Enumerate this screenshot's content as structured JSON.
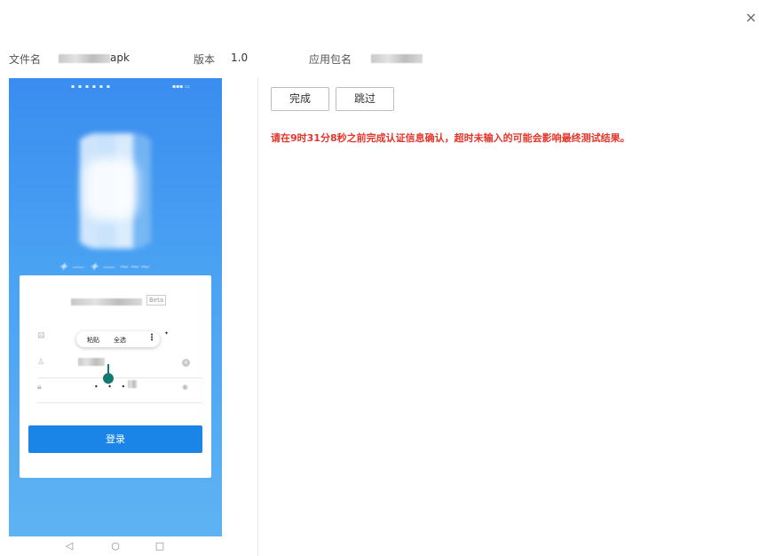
{
  "dialog": {
    "close_icon": "×"
  },
  "info": {
    "filename_label": "文件名",
    "filename_suffix": "apk",
    "version_label": "版本",
    "version_value": "1.0",
    "package_label": "应用包名"
  },
  "phone": {
    "beta": "Beta",
    "context_menu": {
      "paste": "粘贴",
      "select_all": "全选",
      "more": "⋮"
    },
    "password_mask": "• • •",
    "login_button": "登录",
    "nav": {
      "back": "◁",
      "home": "○",
      "recent": "□"
    }
  },
  "actions": {
    "complete": "完成",
    "skip": "跳过"
  },
  "warning_text": "请在9时31分8秒之前完成认证信息确认，超时未输入的可能会影响最终测试结果。"
}
